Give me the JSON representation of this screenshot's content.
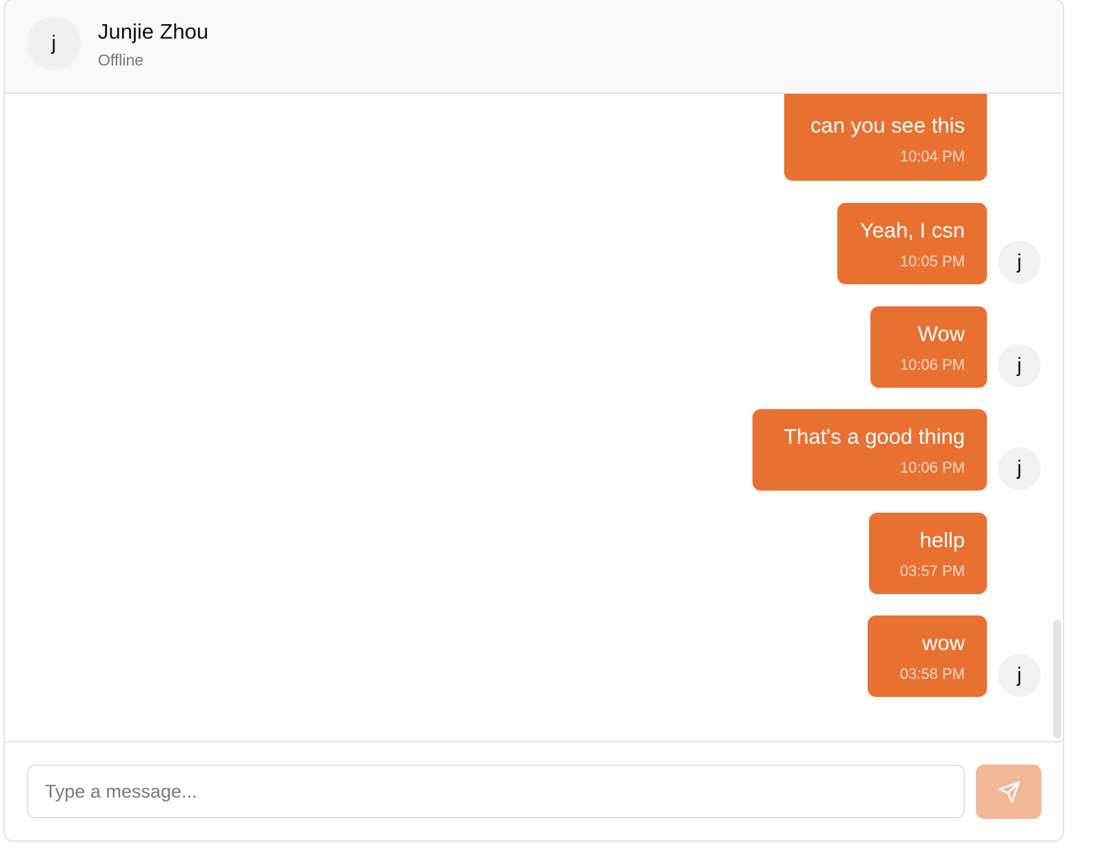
{
  "colors": {
    "bubble": "#e87131",
    "send_button": "#f2b797",
    "header_bg": "#f8f9fa"
  },
  "header": {
    "avatar_initial": "j",
    "contact_name": "Junjie Zhou",
    "status": "Offline"
  },
  "messages": [
    {
      "text": "can you see this",
      "time": "10:04 PM",
      "avatar": ""
    },
    {
      "text": "Yeah, I csn",
      "time": "10:05 PM",
      "avatar": "j"
    },
    {
      "text": "Wow",
      "time": "10:06 PM",
      "avatar": "j"
    },
    {
      "text": "That's a good thing",
      "time": "10:06 PM",
      "avatar": "j"
    },
    {
      "text": "hellp",
      "time": "03:57 PM",
      "avatar": ""
    },
    {
      "text": "wow",
      "time": "03:58 PM",
      "avatar": "j"
    }
  ],
  "composer": {
    "placeholder": "Type a message...",
    "value": "",
    "send_icon": "send-icon"
  }
}
